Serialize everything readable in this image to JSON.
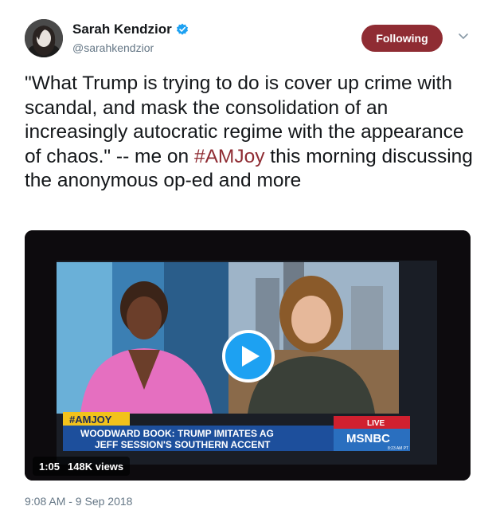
{
  "author": {
    "name": "Sarah Kendzior",
    "handle": "@sarahkendzior",
    "verified": true
  },
  "follow_button": {
    "label": "Following",
    "color": "#8f2c33"
  },
  "tweet": {
    "text_before": "\"What Trump is trying to do is cover up crime with scandal, and mask the consolidation of an increasingly autocratic regime with the appearance of chaos.\" -- me on ",
    "hashtag": "#AMJoy",
    "text_after": " this morning discussing the anonymous op-ed and more"
  },
  "video": {
    "duration": "1:05",
    "views": "148K views",
    "chyron": {
      "tag": "#AMJOY",
      "headline_line1": "WOODWARD BOOK: TRUMP IMITATES AG",
      "headline_line2": "JEFF SESSION'S SOUTHERN ACCENT",
      "live": "LIVE",
      "network": "MSNBC",
      "time": "8:23 AM PT"
    },
    "play_icon": "play-icon"
  },
  "timestamp": "9:08 AM - 9 Sep 2018"
}
